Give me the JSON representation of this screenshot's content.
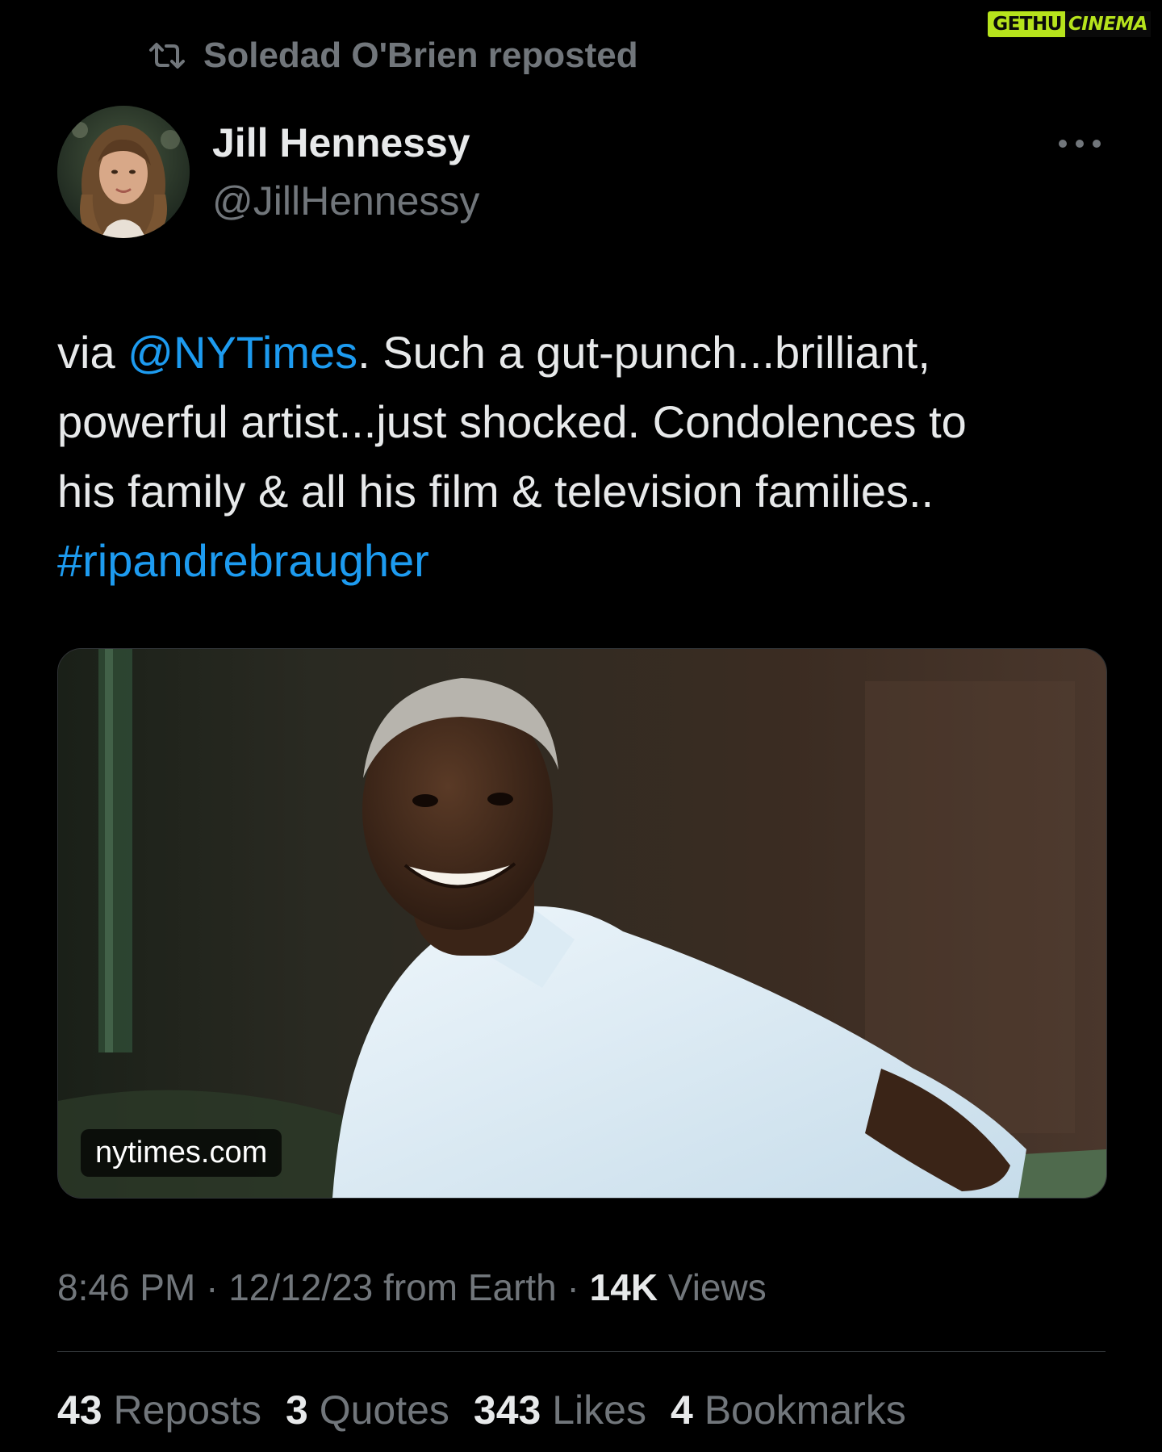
{
  "watermark": {
    "part1": "GETHU",
    "part2": "CINEMA"
  },
  "social_context": {
    "text": "Soledad O'Brien reposted",
    "icon": "repost-icon"
  },
  "author": {
    "name": "Jill Hennessy",
    "handle": "@JillHennessy"
  },
  "tweet": {
    "line1_pre": "via ",
    "mention": "@NYTimes",
    "line1_post": ". Such a gut-punch...brilliant,",
    "line2": "powerful artist...just shocked. Condolences to",
    "line3": "his family & all his film & television families..",
    "hashtag": "#ripandrebraugher"
  },
  "media": {
    "domain": "nytimes.com"
  },
  "meta": {
    "time": "8:46 PM",
    "sep1": " · ",
    "date_source": "12/12/23 from Earth",
    "sep2": " · ",
    "views_count": "14K",
    "views_label": " Views"
  },
  "stats": [
    {
      "count": "43",
      "label": "Reposts"
    },
    {
      "count": "3",
      "label": "Quotes"
    },
    {
      "count": "343",
      "label": "Likes"
    },
    {
      "count": "4",
      "label": "Bookmarks"
    }
  ],
  "colors": {
    "background": "#000000",
    "text_primary": "#e7e9ea",
    "text_secondary": "#71767b",
    "link": "#1d9bf0",
    "divider": "#2f3336",
    "watermark_accent": "#b6e31c"
  }
}
